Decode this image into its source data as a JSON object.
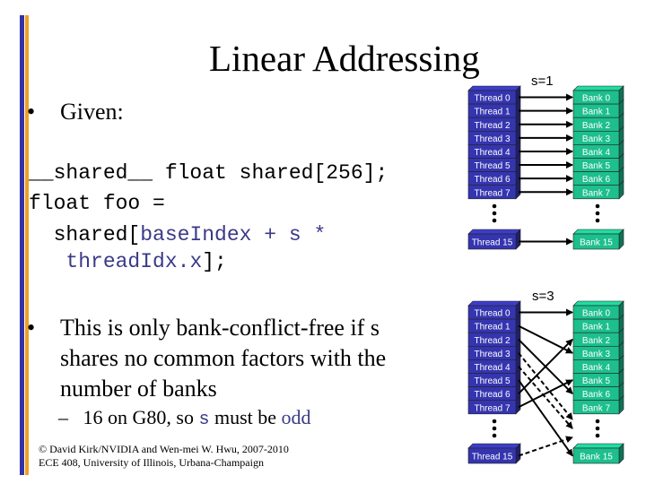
{
  "slide": {
    "title": "Linear Addressing",
    "bullets": [
      {
        "text": "Given:"
      },
      {
        "text": "This is only bank-conflict-free if s shares no common factors with the number of banks"
      }
    ],
    "code": {
      "line1": "__shared__ float shared[256];",
      "line2": "float foo =",
      "line3_pre": "  shared[",
      "line3_blue": "baseIndex + s *",
      "line4_pre": "   ",
      "line4_blue": "threadIdx.x",
      "line4_post": "];"
    },
    "sub_bullet": {
      "dash": "–",
      "pre": "16 on G80, so ",
      "mono": "s",
      "mid": " must be ",
      "emph": "odd"
    },
    "footer": {
      "line1": "© David Kirk/NVIDIA and Wen-mei W. Hwu, 2007-2010",
      "line2": "ECE 408, University of Illinois, Urbana-Champaign"
    },
    "bullet_glyph": "•"
  },
  "colors": {
    "accent_blue": "#3333a8",
    "accent_orange": "#f0a020",
    "thread_box": "#3535b0",
    "bank_box": "#1dbf8c"
  },
  "diagrams": [
    {
      "label": "s=1",
      "stride": 1,
      "threads": [
        "Thread 0",
        "Thread 1",
        "Thread 2",
        "Thread 3",
        "Thread 4",
        "Thread 5",
        "Thread 6",
        "Thread 7"
      ],
      "last_thread": "Thread 15",
      "banks": [
        "Bank 0",
        "Bank 1",
        "Bank 2",
        "Bank 3",
        "Bank 4",
        "Bank 5",
        "Bank 6",
        "Bank 7"
      ],
      "last_bank": "Bank 15",
      "mapping": [
        {
          "thread": 0,
          "bank": 0
        },
        {
          "thread": 1,
          "bank": 1
        },
        {
          "thread": 2,
          "bank": 2
        },
        {
          "thread": 3,
          "bank": 3
        },
        {
          "thread": 4,
          "bank": 4
        },
        {
          "thread": 5,
          "bank": 5
        },
        {
          "thread": 6,
          "bank": 6
        },
        {
          "thread": 7,
          "bank": 7
        },
        {
          "thread": 15,
          "bank": 15
        }
      ]
    },
    {
      "label": "s=3",
      "stride": 3,
      "threads": [
        "Thread 0",
        "Thread 1",
        "Thread 2",
        "Thread 3",
        "Thread 4",
        "Thread 5",
        "Thread 6",
        "Thread 7"
      ],
      "last_thread": "Thread 15",
      "banks": [
        "Bank 0",
        "Bank 1",
        "Bank 2",
        "Bank 3",
        "Bank 4",
        "Bank 5",
        "Bank 6",
        "Bank 7"
      ],
      "last_bank": "Bank 15",
      "mapping": [
        {
          "thread": 0,
          "bank": 0
        },
        {
          "thread": 1,
          "bank": 3
        },
        {
          "thread": 2,
          "bank": 6
        },
        {
          "thread": 3,
          "bank": 9
        },
        {
          "thread": 4,
          "bank": 12
        },
        {
          "thread": 5,
          "bank": 15
        },
        {
          "thread": 6,
          "bank": 2
        },
        {
          "thread": 7,
          "bank": 5
        },
        {
          "thread": 15,
          "bank": 13
        }
      ]
    }
  ]
}
